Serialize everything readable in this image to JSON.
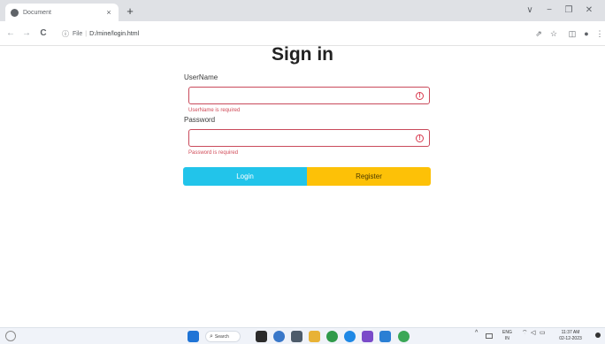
{
  "browser": {
    "tab_title": "Document",
    "tab_close": "×",
    "new_tab": "+",
    "window_controls": {
      "chevron": "∨",
      "minimize": "−",
      "restore": "❐",
      "close": "✕"
    },
    "nav": {
      "back": "←",
      "forward": "→",
      "reload": "C"
    },
    "address": {
      "info_icon": "ⓘ",
      "scheme": "File",
      "separator": "|",
      "url": "D:/mine/login.html"
    },
    "toolbar_icons": {
      "share": "⇗",
      "star": "☆",
      "sidebar": "◫",
      "profile": "●",
      "menu": "⋮"
    }
  },
  "page": {
    "heading": "Sign in",
    "username": {
      "label": "UserName",
      "value": "",
      "error": "UserName is required"
    },
    "password": {
      "label": "Password",
      "value": "",
      "error": "Password is required"
    },
    "warn_glyph": "!",
    "login_label": "Login",
    "register_label": "Register"
  },
  "taskbar": {
    "search_label": "Search",
    "tray": {
      "chevron": "^",
      "lang_top": "ENG",
      "lang_bottom": "IN",
      "time": "11:37 AM",
      "date": "02-12-2023"
    },
    "colors": {
      "start": "#1f74d6",
      "app1": "#2b2b2b",
      "app2": "#3a78c9",
      "app3": "#4d5b6a",
      "app4": "#e8b236",
      "app5": "#2f9a4a",
      "app6": "#1e88e5",
      "app7": "#7a4bc9",
      "app8": "#2a7fd4",
      "app9": "#3aa756"
    }
  },
  "colors": {
    "login": "#22c4ea",
    "register": "#fdc107",
    "error": "#d04a57"
  }
}
